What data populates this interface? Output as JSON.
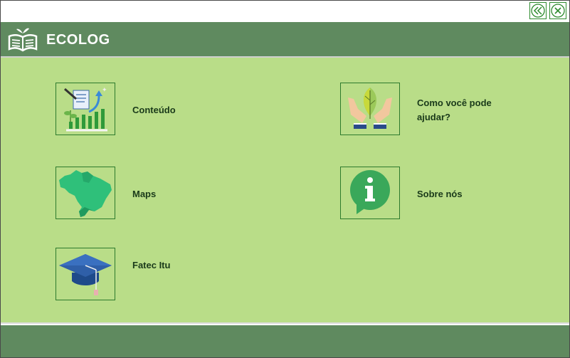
{
  "app": {
    "title": "ECOLOG"
  },
  "menu": [
    {
      "label": "Conteúdo",
      "icon": "growth-chart-icon"
    },
    {
      "label": "Como você pode\najudar?",
      "icon": "hands-leaf-icon"
    },
    {
      "label": "Maps",
      "icon": "brazil-map-icon"
    },
    {
      "label": "Sobre nós",
      "icon": "info-bubble-icon"
    },
    {
      "label": "Fatec Itu",
      "icon": "graduation-cap-icon"
    }
  ],
  "colors": {
    "header": "#5f8a5f",
    "content_bg": "#b9dd88",
    "tile_border": "#2d7a2d",
    "label_text": "#1a3a1a"
  }
}
